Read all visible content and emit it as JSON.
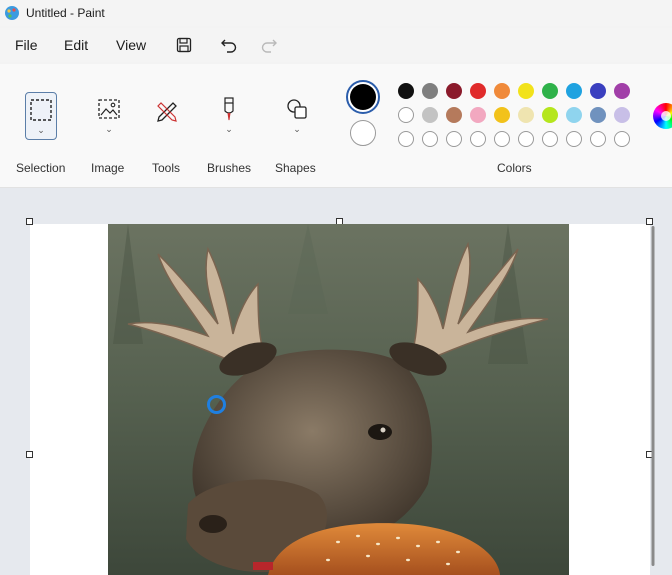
{
  "window": {
    "title": "Untitled - Paint"
  },
  "menu": {
    "file": "File",
    "edit": "Edit",
    "view": "View"
  },
  "ribbon": {
    "groups": {
      "selection": "Selection",
      "image": "Image",
      "tools": "Tools",
      "brushes": "Brushes",
      "shapes": "Shapes",
      "colors": "Colors"
    }
  },
  "colors": {
    "primary": "#000000",
    "secondary": "#ffffff",
    "palette_row1": [
      "#111111",
      "#7f7f7f",
      "#8b1a2b",
      "#e02b2b",
      "#f08a3a",
      "#f2e21b",
      "#2fb24a",
      "#1fa2e0",
      "#3a3fbf",
      "#a13fa8"
    ],
    "palette_row2": [
      "#ffffff",
      "#c3c3c3",
      "#b57a5c",
      "#f2a8c0",
      "#f2c21b",
      "#efe4b0",
      "#b5e61d",
      "#8fd4ee",
      "#7092be",
      "#c8bfe7"
    ],
    "palette_row3": [
      "#ffffff",
      "#ffffff",
      "#ffffff",
      "#ffffff",
      "#ffffff",
      "#ffffff",
      "#ffffff",
      "#ffffff",
      "#ffffff",
      "#ffffff"
    ]
  },
  "icons": {
    "app": "paint-app-icon",
    "save": "save-icon",
    "undo": "undo-icon",
    "redo": "redo-icon",
    "selection": "selection-rectangle-icon",
    "image": "image-icon",
    "tools": "pencil-tools-icon",
    "brushes": "brush-icon",
    "shapes": "shapes-icon",
    "edit_colors": "color-wheel-icon"
  },
  "canvas": {
    "content": "moose-with-burger-image"
  }
}
